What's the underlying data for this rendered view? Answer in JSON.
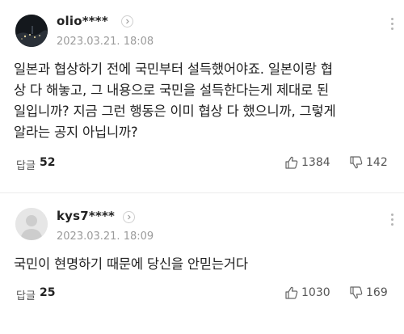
{
  "comments": [
    {
      "username": "olio****",
      "date": "2023.03.21. 18:08",
      "body_lines": [
        "일본과 협상하기 전에 국민부터 설득했어야죠. 일본이랑 협",
        "상 다 해놓고, 그 내용으로 국민을 설득한다는게 제대로 된",
        "일입니까? 지금 그런 행동은 이미 협상 다 했으니까, 그렇게",
        "알라는 공지 아닙니까?"
      ],
      "reply_label": "답글",
      "reply_count": "52",
      "likes": "1384",
      "dislikes": "142"
    },
    {
      "username": "kys7****",
      "date": "2023.03.21. 18:09",
      "body_lines": [
        "국민이 현명하기 때문에 당신을 안믿는거다"
      ],
      "reply_label": "답글",
      "reply_count": "25",
      "likes": "1030",
      "dislikes": "169"
    }
  ],
  "icons": {
    "chevron": "chevron-right-icon",
    "more": "more-vertical-icon",
    "like": "thumbs-up-icon",
    "dislike": "thumbs-down-icon"
  }
}
